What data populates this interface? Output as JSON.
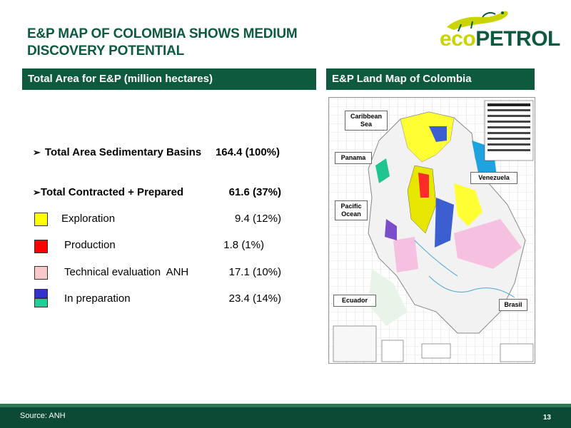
{
  "title": "E&P MAP OF COLOMBIA SHOWS MEDIUM DISCOVERY POTENTIAL",
  "logo": {
    "eco_text": "eco",
    "petrol_text": "PETROL",
    "icon": "iguana-icon"
  },
  "left_panel": {
    "header": "Total Area for E&P (million hectares)",
    "total_sedimentary": {
      "label": "Total Area Sedimentary Basins",
      "value": "164.4 (100%)"
    },
    "total_contracted": {
      "label": "Total Contracted + Prepared",
      "value": "61.6 (37%)"
    },
    "items": [
      {
        "label": "Exploration",
        "value": "9.4 (12%)",
        "color": "#ffff00"
      },
      {
        "label": "Production",
        "value": "1.8 (1%)",
        "color": "#ff0000"
      },
      {
        "label": "Technical evaluation  ANH",
        "value": "17.1 (10%)",
        "color": "#f9c8c8"
      },
      {
        "label": "In preparation",
        "value": "23.4 (14%)",
        "colors": [
          "#3333cc",
          "#1fcf9a"
        ]
      }
    ]
  },
  "right_panel": {
    "header": "E&P Land Map of Colombia",
    "labels": {
      "caribbean": "Caribbean Sea",
      "panama": "Panama",
      "venezuela": "Venezuela",
      "pacific": "Pacific Ocean",
      "ecuador": "Ecuador",
      "brasil": "Brasil"
    }
  },
  "footer": {
    "source": "Source: ANH",
    "page_number": "13"
  },
  "colors": {
    "brand_green": "#0d5a3f",
    "brand_yellow": "#c9d400"
  }
}
